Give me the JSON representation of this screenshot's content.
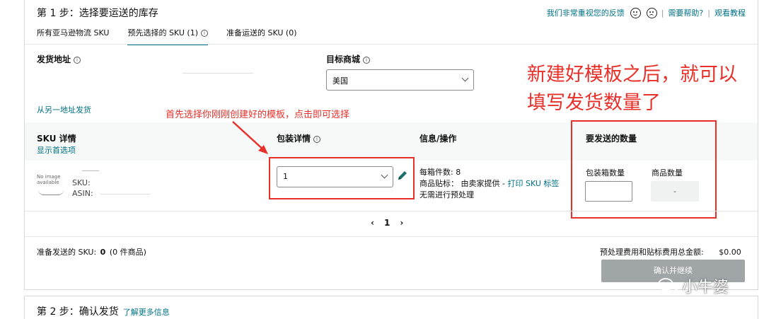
{
  "step1": {
    "title": "第 1 步：选择要运送的库存",
    "feedback_link": "我们非常重视您的反馈",
    "help_link": "需要帮助?",
    "tutorial_link": "观看教程",
    "separator": "|"
  },
  "tabs": [
    {
      "label": "所有亚马逊物流 SKU"
    },
    {
      "label": "预先选择的 SKU (1)"
    },
    {
      "label": "准备运送的 SKU (0)"
    }
  ],
  "ship_from": {
    "label": "发货地址",
    "other_address_link": "从另一地址发货"
  },
  "marketplace": {
    "label": "目标商城",
    "selected": "美国"
  },
  "annotations": {
    "big_line1": "新建好模板之后，就可以",
    "big_line2": "填写发货数量了",
    "small": "首先选择你刚刚创建好的模板，点击即可选择",
    "color": "#e8302a"
  },
  "table_header": {
    "sku_details": "SKU 详情",
    "show_preferences": "显示首选项",
    "packing_details": "包装详情",
    "info_actions": "信息/操作",
    "quantity_to_send": "要发送的数量"
  },
  "row": {
    "no_image_line1": "No image",
    "no_image_line2": "available",
    "sku_label": "SKU:",
    "asin_label": "ASIN:",
    "packing_template": "1",
    "units_per_box": "每箱件数: 8",
    "labeling": "商品贴标： 由卖家提供 - ",
    "print_sku_label": "打印 SKU 标签",
    "prep": "无需进行预处理",
    "box_qty_label": "包装箱数量",
    "unit_qty_label": "商品数量",
    "unit_qty_value": "-"
  },
  "pager": {
    "prev": "‹",
    "page": "1",
    "next": "›"
  },
  "footer": {
    "ready_label": "准备发送的 SKU:",
    "ready_count": "0",
    "ready_units": "(0 件商品)",
    "fee_label": "预处理费用和贴标费用总金额:",
    "fee_value": "$0.00",
    "confirm_button": "确认并继续"
  },
  "watermark": {
    "text": "小牛婆"
  },
  "step2": {
    "title": "第 2 步：确认发货",
    "more_link": "了解更多信息"
  },
  "colors": {
    "link": "#007185",
    "annotation_red": "#e8302a",
    "button_disabled": "#a0a6a8"
  }
}
